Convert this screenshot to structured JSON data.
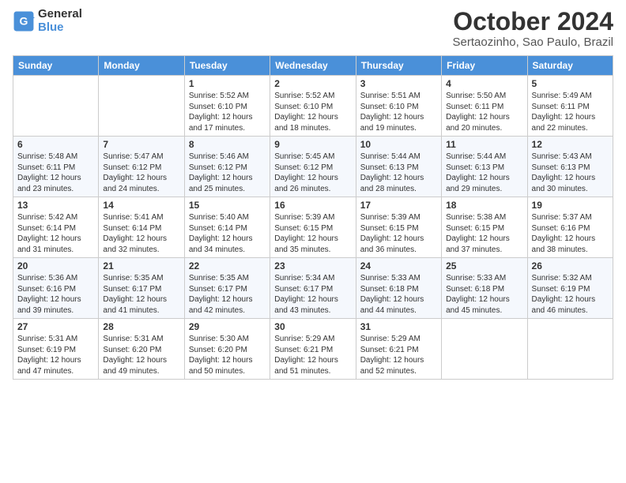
{
  "logo": {
    "line1": "General",
    "line2": "Blue"
  },
  "title": "October 2024",
  "subtitle": "Sertaozinho, Sao Paulo, Brazil",
  "days_of_week": [
    "Sunday",
    "Monday",
    "Tuesday",
    "Wednesday",
    "Thursday",
    "Friday",
    "Saturday"
  ],
  "weeks": [
    [
      {
        "day": "",
        "info": ""
      },
      {
        "day": "",
        "info": ""
      },
      {
        "day": "1",
        "info": "Sunrise: 5:52 AM\nSunset: 6:10 PM\nDaylight: 12 hours and 17 minutes."
      },
      {
        "day": "2",
        "info": "Sunrise: 5:52 AM\nSunset: 6:10 PM\nDaylight: 12 hours and 18 minutes."
      },
      {
        "day": "3",
        "info": "Sunrise: 5:51 AM\nSunset: 6:10 PM\nDaylight: 12 hours and 19 minutes."
      },
      {
        "day": "4",
        "info": "Sunrise: 5:50 AM\nSunset: 6:11 PM\nDaylight: 12 hours and 20 minutes."
      },
      {
        "day": "5",
        "info": "Sunrise: 5:49 AM\nSunset: 6:11 PM\nDaylight: 12 hours and 22 minutes."
      }
    ],
    [
      {
        "day": "6",
        "info": "Sunrise: 5:48 AM\nSunset: 6:11 PM\nDaylight: 12 hours and 23 minutes."
      },
      {
        "day": "7",
        "info": "Sunrise: 5:47 AM\nSunset: 6:12 PM\nDaylight: 12 hours and 24 minutes."
      },
      {
        "day": "8",
        "info": "Sunrise: 5:46 AM\nSunset: 6:12 PM\nDaylight: 12 hours and 25 minutes."
      },
      {
        "day": "9",
        "info": "Sunrise: 5:45 AM\nSunset: 6:12 PM\nDaylight: 12 hours and 26 minutes."
      },
      {
        "day": "10",
        "info": "Sunrise: 5:44 AM\nSunset: 6:13 PM\nDaylight: 12 hours and 28 minutes."
      },
      {
        "day": "11",
        "info": "Sunrise: 5:44 AM\nSunset: 6:13 PM\nDaylight: 12 hours and 29 minutes."
      },
      {
        "day": "12",
        "info": "Sunrise: 5:43 AM\nSunset: 6:13 PM\nDaylight: 12 hours and 30 minutes."
      }
    ],
    [
      {
        "day": "13",
        "info": "Sunrise: 5:42 AM\nSunset: 6:14 PM\nDaylight: 12 hours and 31 minutes."
      },
      {
        "day": "14",
        "info": "Sunrise: 5:41 AM\nSunset: 6:14 PM\nDaylight: 12 hours and 32 minutes."
      },
      {
        "day": "15",
        "info": "Sunrise: 5:40 AM\nSunset: 6:14 PM\nDaylight: 12 hours and 34 minutes."
      },
      {
        "day": "16",
        "info": "Sunrise: 5:39 AM\nSunset: 6:15 PM\nDaylight: 12 hours and 35 minutes."
      },
      {
        "day": "17",
        "info": "Sunrise: 5:39 AM\nSunset: 6:15 PM\nDaylight: 12 hours and 36 minutes."
      },
      {
        "day": "18",
        "info": "Sunrise: 5:38 AM\nSunset: 6:15 PM\nDaylight: 12 hours and 37 minutes."
      },
      {
        "day": "19",
        "info": "Sunrise: 5:37 AM\nSunset: 6:16 PM\nDaylight: 12 hours and 38 minutes."
      }
    ],
    [
      {
        "day": "20",
        "info": "Sunrise: 5:36 AM\nSunset: 6:16 PM\nDaylight: 12 hours and 39 minutes."
      },
      {
        "day": "21",
        "info": "Sunrise: 5:35 AM\nSunset: 6:17 PM\nDaylight: 12 hours and 41 minutes."
      },
      {
        "day": "22",
        "info": "Sunrise: 5:35 AM\nSunset: 6:17 PM\nDaylight: 12 hours and 42 minutes."
      },
      {
        "day": "23",
        "info": "Sunrise: 5:34 AM\nSunset: 6:17 PM\nDaylight: 12 hours and 43 minutes."
      },
      {
        "day": "24",
        "info": "Sunrise: 5:33 AM\nSunset: 6:18 PM\nDaylight: 12 hours and 44 minutes."
      },
      {
        "day": "25",
        "info": "Sunrise: 5:33 AM\nSunset: 6:18 PM\nDaylight: 12 hours and 45 minutes."
      },
      {
        "day": "26",
        "info": "Sunrise: 5:32 AM\nSunset: 6:19 PM\nDaylight: 12 hours and 46 minutes."
      }
    ],
    [
      {
        "day": "27",
        "info": "Sunrise: 5:31 AM\nSunset: 6:19 PM\nDaylight: 12 hours and 47 minutes."
      },
      {
        "day": "28",
        "info": "Sunrise: 5:31 AM\nSunset: 6:20 PM\nDaylight: 12 hours and 49 minutes."
      },
      {
        "day": "29",
        "info": "Sunrise: 5:30 AM\nSunset: 6:20 PM\nDaylight: 12 hours and 50 minutes."
      },
      {
        "day": "30",
        "info": "Sunrise: 5:29 AM\nSunset: 6:21 PM\nDaylight: 12 hours and 51 minutes."
      },
      {
        "day": "31",
        "info": "Sunrise: 5:29 AM\nSunset: 6:21 PM\nDaylight: 12 hours and 52 minutes."
      },
      {
        "day": "",
        "info": ""
      },
      {
        "day": "",
        "info": ""
      }
    ]
  ]
}
